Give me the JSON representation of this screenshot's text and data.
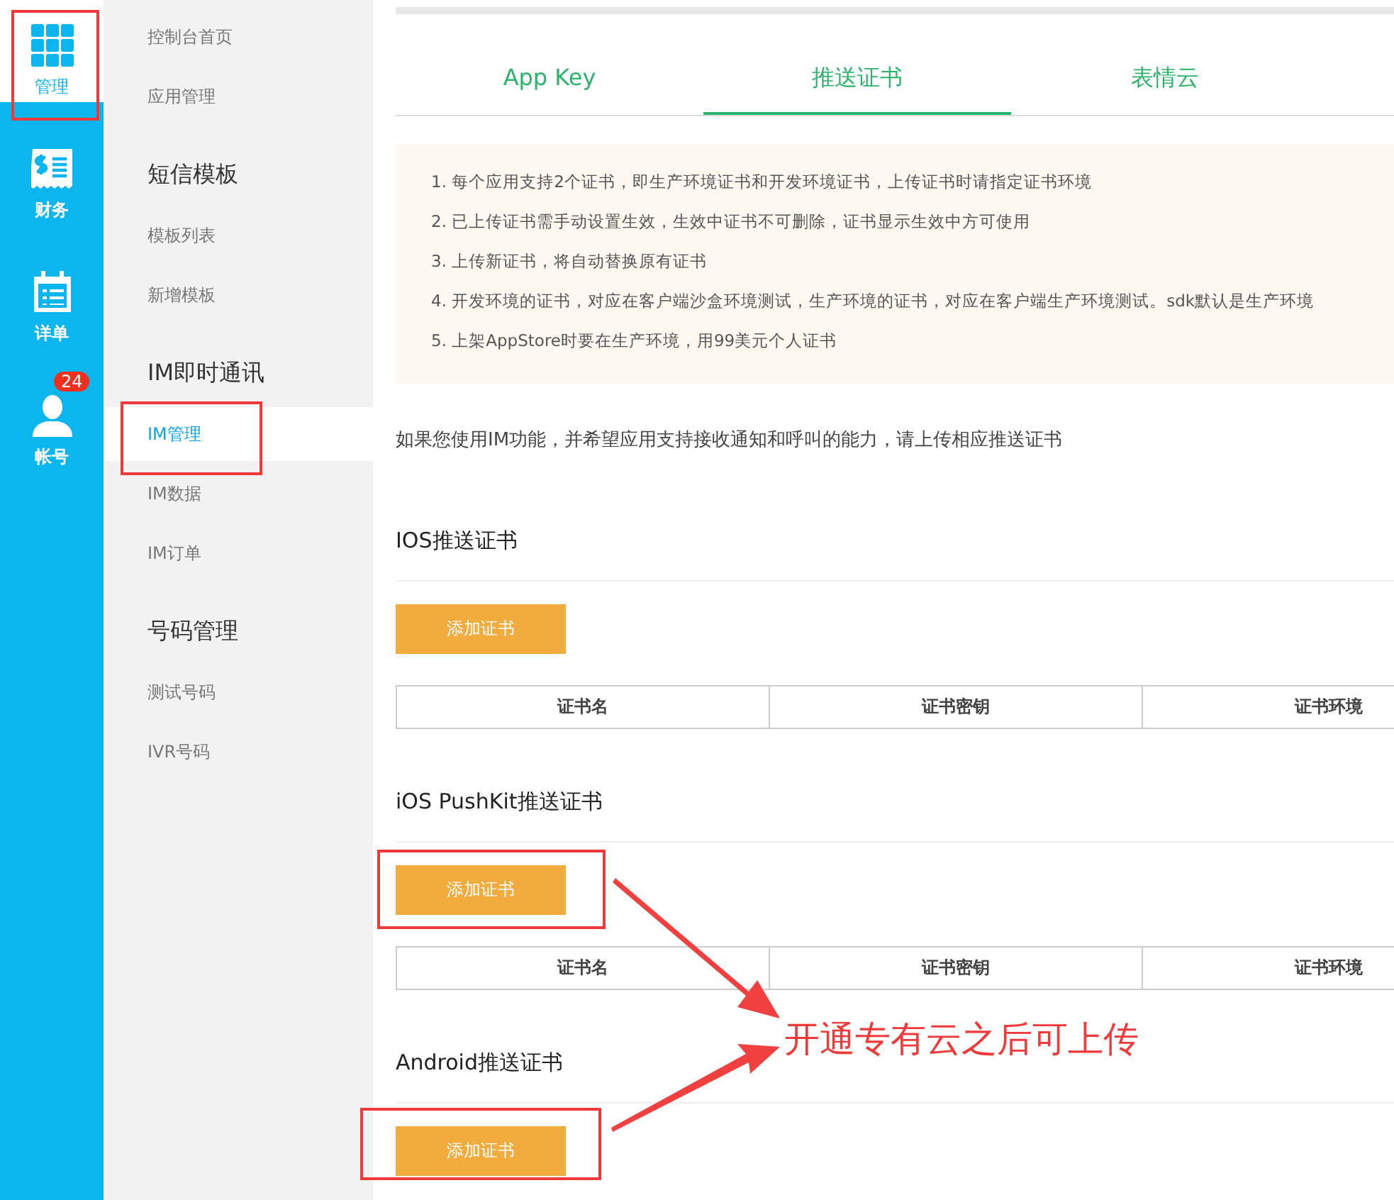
{
  "rail": [
    {
      "label": "管理",
      "kind": "grid",
      "selected": true
    },
    {
      "label": "财务",
      "kind": "receipt",
      "selected": false
    },
    {
      "label": "详单",
      "kind": "calendar",
      "selected": false
    },
    {
      "label": "帐号",
      "kind": "person",
      "selected": false,
      "badge": "24"
    }
  ],
  "menu_groups": [
    {
      "items": [
        {
          "label": "控制台首页",
          "selected": false
        },
        {
          "label": "应用管理",
          "selected": false
        }
      ]
    },
    {
      "title": "短信模板",
      "items": [
        {
          "label": "模板列表",
          "selected": false
        },
        {
          "label": "新增模板",
          "selected": false
        }
      ]
    },
    {
      "title": "IM即时通讯",
      "items": [
        {
          "label": "IM管理",
          "selected": true
        },
        {
          "label": "IM数据",
          "selected": false
        },
        {
          "label": "IM订单",
          "selected": false
        }
      ]
    },
    {
      "title": "号码管理",
      "items": [
        {
          "label": "测试号码",
          "selected": false
        },
        {
          "label": "IVR号码",
          "selected": false
        }
      ]
    }
  ],
  "tabs": [
    {
      "label": "App Key",
      "selected": false
    },
    {
      "label": "推送证书",
      "selected": true
    },
    {
      "label": "表情云",
      "selected": false
    }
  ],
  "notice": [
    "1. 每个应用支持2个证书，即生产环境证书和开发环境证书，上传证书时请指定证书环境",
    "2. 已上传证书需手动设置生效，生效中证书不可删除，证书显示生效中方可使用",
    "3. 上传新证书，将自动替换原有证书",
    "4. 开发环境的证书，对应在客户端沙盒环境测试，生产环境的证书，对应在客户端生产环境测试。sdk默认是生产环境",
    "5. 上架AppStore时要在生产环境，用99美元个人证书"
  ],
  "intro": "如果您使用IM功能，并希望应用支持接收通知和呼叫的能力，请上传相应推送证书",
  "sections": [
    {
      "title": "IOS推送证书",
      "button": "添加证书",
      "columns": [
        "证书名",
        "证书密钥",
        "证书环境"
      ]
    },
    {
      "title": "iOS PushKit推送证书",
      "button": "添加证书",
      "columns": [
        "证书名",
        "证书密钥",
        "证书环境"
      ]
    },
    {
      "title": "Android推送证书",
      "button": "添加证书"
    }
  ],
  "annotation": {
    "text": "开通专有云之后可上传"
  }
}
